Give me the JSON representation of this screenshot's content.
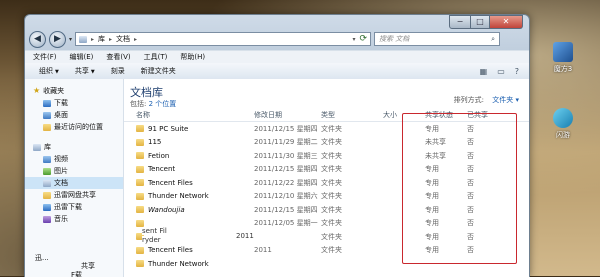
{
  "window": {
    "controls": {
      "min": "−",
      "max": "□",
      "close": "✕"
    }
  },
  "address": {
    "segments": [
      "库",
      "文档"
    ],
    "search_placeholder": "搜索 文档"
  },
  "menu": [
    "文件(F)",
    "编辑(E)",
    "查看(V)",
    "工具(T)",
    "帮助(H)"
  ],
  "toolbar": {
    "organize": "组织",
    "share": "共享",
    "burn": "刻录",
    "new_folder": "新建文件夹"
  },
  "sidebar": {
    "favorites": {
      "label": "收藏夹",
      "items": [
        "下载",
        "桌面",
        "最近访问的位置"
      ]
    },
    "libraries": {
      "label": "库",
      "items": [
        "视频",
        "图片",
        "文档",
        "迅雷网盘共享",
        "迅雷下载",
        "音乐"
      ]
    },
    "glitch": [
      "迅...",
      "共享",
      "F载"
    ]
  },
  "library": {
    "title": "文档库",
    "subtitle_prefix": "包括:",
    "subtitle_link": "2 个位置",
    "arrange_label": "排列方式:",
    "arrange_value": "文件夹 ▾"
  },
  "columns": [
    "名称",
    "修改日期",
    "类型",
    "大小",
    "共享状态",
    "已共享"
  ],
  "rows": [
    {
      "name": "91 PC Suite",
      "date": "2011/12/15 星期四",
      "type": "文件夹",
      "share": "专用",
      "shared": "否"
    },
    {
      "name": "115",
      "date": "2011/11/29 星期二",
      "type": "文件夹",
      "share": "未共享",
      "shared": "否"
    },
    {
      "name": "Fetion",
      "date": "2011/11/30 星期三",
      "type": "文件夹",
      "share": "未共享",
      "shared": "否"
    },
    {
      "name": "Tencent",
      "date": "2011/12/15 星期四",
      "type": "文件夹",
      "share": "专用",
      "shared": "否"
    },
    {
      "name": "Tencent Files",
      "date": "2011/12/22 星期四",
      "type": "文件夹",
      "share": "专用",
      "shared": "否"
    },
    {
      "name": "Thunder Network",
      "date": "2011/12/10 星期六",
      "type": "文件夹",
      "share": "专用",
      "shared": "否"
    },
    {
      "name": "Wandoujia",
      "date": "2011/12/15 星期四",
      "type": "文件夹",
      "share": "专用",
      "shared": "否"
    },
    {
      "name": "",
      "date": "2011/12/05 星期一",
      "type": "文件夹",
      "share": "专用",
      "shared": "否"
    },
    {
      "name": "",
      "date": "",
      "type": "文件夹",
      "share": "专用",
      "shared": "否"
    },
    {
      "name": "Tencent Files",
      "date": "2011",
      "type": "文件夹",
      "share": "专用",
      "shared": "否"
    },
    {
      "name": "Thunder Network",
      "date": "",
      "type": "",
      "share": "",
      "shared": ""
    }
  ],
  "glitch_text": [
    "sent Fil",
    "ryder",
    "2011"
  ],
  "desktop": [
    {
      "label": "魔方3",
      "color": "#2f6fb5"
    },
    {
      "label": "闪游",
      "color": "#2a8fbf"
    }
  ]
}
